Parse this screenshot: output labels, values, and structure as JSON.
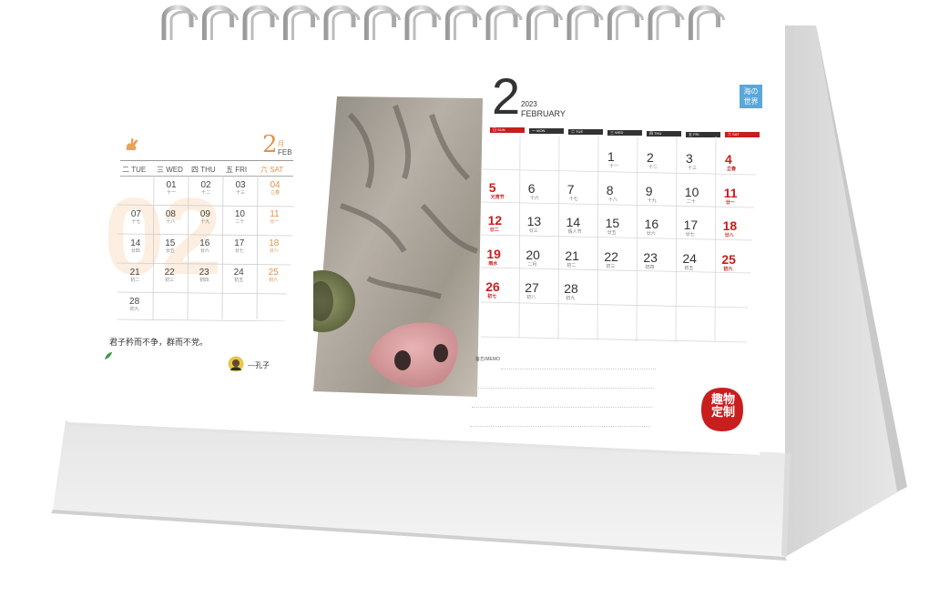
{
  "left_page": {
    "month_number": "2",
    "month_cn": "月",
    "month_abbr": "FEB",
    "big_watermark": "02",
    "weekdays": [
      "二 TUE",
      "三 WED",
      "四 THU",
      "五 FRI",
      "六 SAT"
    ],
    "days": [
      {
        "d": "01",
        "l": "十一"
      },
      {
        "d": "02",
        "l": "十二"
      },
      {
        "d": "03",
        "l": "十三"
      },
      {
        "d": "04",
        "l": "立春"
      },
      {
        "d": "07",
        "l": "十七"
      },
      {
        "d": "08",
        "l": "十八"
      },
      {
        "d": "09",
        "l": "十九"
      },
      {
        "d": "10",
        "l": "二十"
      },
      {
        "d": "11",
        "l": "廿一"
      },
      {
        "d": "14",
        "l": "廿四"
      },
      {
        "d": "15",
        "l": "廿五"
      },
      {
        "d": "16",
        "l": "廿六"
      },
      {
        "d": "17",
        "l": "廿七"
      },
      {
        "d": "18",
        "l": "廿八"
      },
      {
        "d": "21",
        "l": "初二"
      },
      {
        "d": "22",
        "l": "初三"
      },
      {
        "d": "23",
        "l": "初四"
      },
      {
        "d": "24",
        "l": "初五"
      },
      {
        "d": "25",
        "l": "初六"
      },
      {
        "d": "28",
        "l": "初九"
      }
    ],
    "quote": "君子矜而不争，群而不党。",
    "author": "—孔子"
  },
  "right_page": {
    "month_number": "2",
    "year": "2023",
    "month_name": "FEBRUARY",
    "stamp_top": "海の",
    "stamp_bottom": "世界",
    "weekdays": [
      "日 SUN",
      "一 MON",
      "二 TUE",
      "三 WED",
      "四 THU",
      "五 FRI",
      "六 SAT"
    ],
    "days": [
      {
        "d": "1",
        "l": "十一"
      },
      {
        "d": "2",
        "l": "十二"
      },
      {
        "d": "3",
        "l": "十三"
      },
      {
        "d": "4",
        "l": "立春"
      },
      {
        "d": "5",
        "l": "元宵节"
      },
      {
        "d": "6",
        "l": "十六"
      },
      {
        "d": "7",
        "l": "十七"
      },
      {
        "d": "8",
        "l": "十八"
      },
      {
        "d": "9",
        "l": "十九"
      },
      {
        "d": "10",
        "l": "二十"
      },
      {
        "d": "11",
        "l": "廿一"
      },
      {
        "d": "12",
        "l": "廿二"
      },
      {
        "d": "13",
        "l": "廿三"
      },
      {
        "d": "14",
        "l": "情人节"
      },
      {
        "d": "15",
        "l": "廿五"
      },
      {
        "d": "16",
        "l": "廿六"
      },
      {
        "d": "17",
        "l": "廿七"
      },
      {
        "d": "18",
        "l": "廿八"
      },
      {
        "d": "19",
        "l": "雨水"
      },
      {
        "d": "20",
        "l": "二月"
      },
      {
        "d": "21",
        "l": "初二"
      },
      {
        "d": "22",
        "l": "初三"
      },
      {
        "d": "23",
        "l": "初四"
      },
      {
        "d": "24",
        "l": "初五"
      },
      {
        "d": "25",
        "l": "初六"
      },
      {
        "d": "26",
        "l": "初七"
      },
      {
        "d": "27",
        "l": "初八"
      },
      {
        "d": "28",
        "l": "初九"
      }
    ],
    "memo_label": "备忘/MEMO",
    "seal_text_1": "趣物",
    "seal_text_2": "定制"
  },
  "colors": {
    "left_accent": "#e0934a",
    "right_red": "#c81e1e",
    "header_dark": "#333333",
    "stamp_blue": "#5aa7dc"
  }
}
